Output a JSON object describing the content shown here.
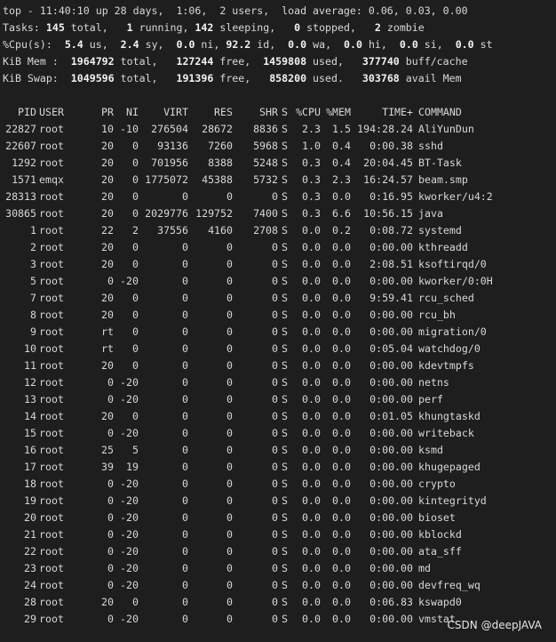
{
  "summary": {
    "top_line": {
      "prefix": "top - ",
      "time": "11:40:10",
      "uptime_text": " up 28 days,  1:06,  ",
      "users": "2",
      "users_suffix": " users,  load average: ",
      "load_1": "0.06",
      "sep1": ", ",
      "load_5": "0.03",
      "sep2": ", ",
      "load_15": "0.00"
    },
    "tasks": {
      "label": "Tasks: ",
      "total": "145",
      "total_label": " total,   ",
      "running": "1",
      "running_label": " running, ",
      "sleeping": "142",
      "sleeping_label": " sleeping,   ",
      "stopped": "0",
      "stopped_label": " stopped,   ",
      "zombie": "2",
      "zombie_label": " zombie"
    },
    "cpu": {
      "label": "%Cpu(s):  ",
      "us": "5.4",
      "us_label": " us,  ",
      "sy": "2.4",
      "sy_label": " sy,  ",
      "ni": "0.0",
      "ni_label": " ni, ",
      "id": "92.2",
      "id_label": " id,  ",
      "wa": "0.0",
      "wa_label": " wa,  ",
      "hi": "0.0",
      "hi_label": " hi,  ",
      "si": "0.0",
      "si_label": " si,  ",
      "st": "0.0",
      "st_label": " st"
    },
    "mem": {
      "label": "KiB Mem :  ",
      "total": "1964792",
      "total_label": " total,   ",
      "free": "127244",
      "free_label": " free,  ",
      "used": "1459808",
      "used_label": " used,   ",
      "buff": "377740",
      "buff_label": " buff/cache"
    },
    "swap": {
      "label": "KiB Swap:  ",
      "total": "1049596",
      "total_label": " total,   ",
      "free": "191396",
      "free_label": " free,   ",
      "used": "858200",
      "used_label": " used.   ",
      "avail": "303768",
      "avail_label": " avail Mem"
    }
  },
  "columns": [
    "PID",
    "USER",
    "PR",
    "NI",
    "VIRT",
    "RES",
    "SHR",
    "S",
    "%CPU",
    "%MEM",
    "TIME+",
    "COMMAND"
  ],
  "processes": [
    [
      "22827",
      "root",
      "10",
      "-10",
      "276504",
      "28672",
      "8836",
      "S",
      "2.3",
      "1.5",
      "194:28.24",
      "AliYunDun"
    ],
    [
      "22607",
      "root",
      "20",
      "0",
      "93136",
      "7260",
      "5968",
      "S",
      "1.0",
      "0.4",
      "0:00.38",
      "sshd"
    ],
    [
      "1292",
      "root",
      "20",
      "0",
      "701956",
      "8388",
      "5248",
      "S",
      "0.3",
      "0.4",
      "20:04.45",
      "BT-Task"
    ],
    [
      "1571",
      "emqx",
      "20",
      "0",
      "1775072",
      "45388",
      "5732",
      "S",
      "0.3",
      "2.3",
      "16:24.57",
      "beam.smp"
    ],
    [
      "28313",
      "root",
      "20",
      "0",
      "0",
      "0",
      "0",
      "S",
      "0.3",
      "0.0",
      "0:16.95",
      "kworker/u4:2"
    ],
    [
      "30865",
      "root",
      "20",
      "0",
      "2029776",
      "129752",
      "7400",
      "S",
      "0.3",
      "6.6",
      "10:56.15",
      "java"
    ],
    [
      "1",
      "root",
      "22",
      "2",
      "37556",
      "4160",
      "2708",
      "S",
      "0.0",
      "0.2",
      "0:08.72",
      "systemd"
    ],
    [
      "2",
      "root",
      "20",
      "0",
      "0",
      "0",
      "0",
      "S",
      "0.0",
      "0.0",
      "0:00.00",
      "kthreadd"
    ],
    [
      "3",
      "root",
      "20",
      "0",
      "0",
      "0",
      "0",
      "S",
      "0.0",
      "0.0",
      "2:08.51",
      "ksoftirqd/0"
    ],
    [
      "5",
      "root",
      "0",
      "-20",
      "0",
      "0",
      "0",
      "S",
      "0.0",
      "0.0",
      "0:00.00",
      "kworker/0:0H"
    ],
    [
      "7",
      "root",
      "20",
      "0",
      "0",
      "0",
      "0",
      "S",
      "0.0",
      "0.0",
      "9:59.41",
      "rcu_sched"
    ],
    [
      "8",
      "root",
      "20",
      "0",
      "0",
      "0",
      "0",
      "S",
      "0.0",
      "0.0",
      "0:00.00",
      "rcu_bh"
    ],
    [
      "9",
      "root",
      "rt",
      "0",
      "0",
      "0",
      "0",
      "S",
      "0.0",
      "0.0",
      "0:00.00",
      "migration/0"
    ],
    [
      "10",
      "root",
      "rt",
      "0",
      "0",
      "0",
      "0",
      "S",
      "0.0",
      "0.0",
      "0:05.04",
      "watchdog/0"
    ],
    [
      "11",
      "root",
      "20",
      "0",
      "0",
      "0",
      "0",
      "S",
      "0.0",
      "0.0",
      "0:00.00",
      "kdevtmpfs"
    ],
    [
      "12",
      "root",
      "0",
      "-20",
      "0",
      "0",
      "0",
      "S",
      "0.0",
      "0.0",
      "0:00.00",
      "netns"
    ],
    [
      "13",
      "root",
      "0",
      "-20",
      "0",
      "0",
      "0",
      "S",
      "0.0",
      "0.0",
      "0:00.00",
      "perf"
    ],
    [
      "14",
      "root",
      "20",
      "0",
      "0",
      "0",
      "0",
      "S",
      "0.0",
      "0.0",
      "0:01.05",
      "khungtaskd"
    ],
    [
      "15",
      "root",
      "0",
      "-20",
      "0",
      "0",
      "0",
      "S",
      "0.0",
      "0.0",
      "0:00.00",
      "writeback"
    ],
    [
      "16",
      "root",
      "25",
      "5",
      "0",
      "0",
      "0",
      "S",
      "0.0",
      "0.0",
      "0:00.00",
      "ksmd"
    ],
    [
      "17",
      "root",
      "39",
      "19",
      "0",
      "0",
      "0",
      "S",
      "0.0",
      "0.0",
      "0:00.00",
      "khugepaged"
    ],
    [
      "18",
      "root",
      "0",
      "-20",
      "0",
      "0",
      "0",
      "S",
      "0.0",
      "0.0",
      "0:00.00",
      "crypto"
    ],
    [
      "19",
      "root",
      "0",
      "-20",
      "0",
      "0",
      "0",
      "S",
      "0.0",
      "0.0",
      "0:00.00",
      "kintegrityd"
    ],
    [
      "20",
      "root",
      "0",
      "-20",
      "0",
      "0",
      "0",
      "S",
      "0.0",
      "0.0",
      "0:00.00",
      "bioset"
    ],
    [
      "21",
      "root",
      "0",
      "-20",
      "0",
      "0",
      "0",
      "S",
      "0.0",
      "0.0",
      "0:00.00",
      "kblockd"
    ],
    [
      "22",
      "root",
      "0",
      "-20",
      "0",
      "0",
      "0",
      "S",
      "0.0",
      "0.0",
      "0:00.00",
      "ata_sff"
    ],
    [
      "23",
      "root",
      "0",
      "-20",
      "0",
      "0",
      "0",
      "S",
      "0.0",
      "0.0",
      "0:00.00",
      "md"
    ],
    [
      "24",
      "root",
      "0",
      "-20",
      "0",
      "0",
      "0",
      "S",
      "0.0",
      "0.0",
      "0:00.00",
      "devfreq_wq"
    ],
    [
      "28",
      "root",
      "20",
      "0",
      "0",
      "0",
      "0",
      "S",
      "0.0",
      "0.0",
      "0:06.83",
      "kswapd0"
    ],
    [
      "29",
      "root",
      "0",
      "-20",
      "0",
      "0",
      "0",
      "S",
      "0.0",
      "0.0",
      "0:00.00",
      "vmstat"
    ]
  ],
  "watermark": "CSDN @deepJAVA",
  "colors": {
    "background": "#1e1e1e",
    "text": "#d8d8d8",
    "bold_text": "#f2f2f2"
  }
}
